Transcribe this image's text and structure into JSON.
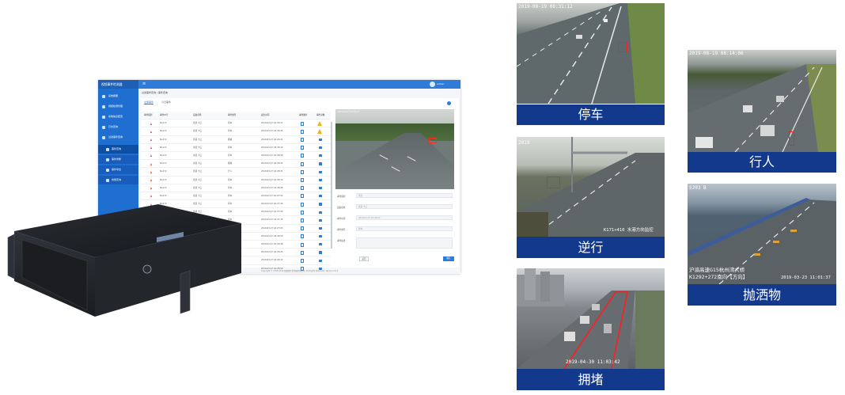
{
  "app": {
    "brand": "视频事件检测器",
    "menu_toggle": "≡",
    "user_name": "admin",
    "sidebar": [
      {
        "label": "系统概要"
      },
      {
        "label": "视频检测管理"
      },
      {
        "label": "系统信息配置"
      },
      {
        "label": "日志查询"
      },
      {
        "label": "过滤事件查询"
      },
      {
        "label": "事件查询"
      },
      {
        "label": "事件录像"
      },
      {
        "label": "事件导出"
      },
      {
        "label": "告警查询"
      }
    ],
    "breadcrumb": "过滤事件查询 / 事件查询",
    "tabs": [
      "全部事件",
      "今日事件"
    ],
    "table": {
      "headers": [
        "事件级别",
        "事件ID号",
        "设备名称",
        "事件类型",
        "发生时间",
        "事件图片",
        "事件录像"
      ],
      "rows": [
        {
          "id": "No172",
          "device": "省道·卡口",
          "type": "停车",
          "time": "2019-03-27 16:29:47"
        },
        {
          "id": "No172",
          "device": "省道·卡口",
          "type": "停车",
          "time": "2019-03-27 16:29:34"
        },
        {
          "id": "No172",
          "device": "省道·卡口",
          "type": "拥堵",
          "time": "2019-03-27 16:29:21"
        },
        {
          "id": "No172",
          "device": "省道·卡口",
          "type": "停车",
          "time": "2019-03-27 16:29:10"
        },
        {
          "id": "No172",
          "device": "省道·卡口",
          "type": "停车",
          "time": "2019-03-27 16:28:58"
        },
        {
          "id": "No172",
          "device": "省道·卡口",
          "type": "拥堵",
          "time": "2019-03-27 16:28:45"
        },
        {
          "id": "No172",
          "device": "省道·卡口",
          "type": "行人",
          "time": "2019-03-27 16:28:31"
        },
        {
          "id": "No172",
          "device": "省道·卡口",
          "type": "停车",
          "time": "2019-03-27 16:28:19"
        },
        {
          "id": "No172",
          "device": "省道·卡口",
          "type": "停车",
          "time": "2019-03-27 16:28:06"
        },
        {
          "id": "No172",
          "device": "省道·卡口",
          "type": "停车",
          "time": "2019-03-27 16:27:52"
        },
        {
          "id": "No172",
          "device": "省道·卡口",
          "type": "停车",
          "time": "2019-03-27 16:27:40"
        },
        {
          "id": "No172",
          "device": "省道·卡口",
          "type": "停车",
          "time": "2019-03-27 16:27:28"
        },
        {
          "id": "No172",
          "device": "省道·卡口",
          "type": "停车",
          "time": "2019-03-27 16:27:15"
        },
        {
          "id": "No172",
          "device": "省道·卡口",
          "type": "停车",
          "time": "2019-03-27 16:27:03"
        },
        {
          "id": "No172",
          "device": "省道·卡口",
          "type": "停车",
          "time": "2019-03-27 16:26:50"
        },
        {
          "id": "No172",
          "device": "省道·卡口",
          "type": "停车",
          "time": "2019-03-27 16:26:38"
        },
        {
          "id": "No172",
          "device": "省道·卡口",
          "type": "拥堵",
          "time": "2019-03-27 16:26:25"
        },
        {
          "id": "No172",
          "device": "省道·卡口",
          "type": "停车",
          "time": "2019-03-27 16:26:12"
        },
        {
          "id": "No172",
          "device": "省道·卡口",
          "type": "停车",
          "time": "2019-03-27 16:26:00"
        }
      ]
    },
    "preview_osd": "2019-03-27 16:29:47",
    "form": [
      {
        "label": "事件级别",
        "value": "紧急"
      },
      {
        "label": "设备名称",
        "value": "省道·卡口"
      },
      {
        "label": "事件时间",
        "value": "2019-03-27 16:29:47"
      },
      {
        "label": "事件类型",
        "value": "停车"
      },
      {
        "label": "事件描述",
        "value": ""
      }
    ],
    "btn_return": "返回",
    "btn_confirm": "确认",
    "footer": "Copyright © 2018-2019 视频事件检测器有限公司. All Rights Reserved. Version 2.0.0"
  },
  "tiles": {
    "parking": {
      "caption": "停车",
      "osd": "2019-08-19 08:31:12"
    },
    "pedestrian": {
      "caption": "行人",
      "osd": "2019-08-19 08:14:06"
    },
    "wrong_way": {
      "caption": "逆行",
      "osd_top": "2019",
      "osd_bottom": "K171+410 水港方向监控"
    },
    "debris": {
      "caption": "抛洒物",
      "osd_top": "S203 B",
      "osd_bottom1": "沪渝高速G15杭州湾大桥",
      "osd_bottom2": "K1292+272南向【方向】",
      "osd_date": "2019-03-23 11:01:37"
    },
    "congestion": {
      "caption": "拥堵",
      "osd": "2019-04-30 11:03:42"
    }
  },
  "colors": {
    "caption_bg": "#13398c",
    "app_blue": "#2f7bd8",
    "sidebar_blue": "#1f6fd1",
    "detection_red": "#ff1e1e",
    "alert_red": "#e64a3b",
    "warning_yellow": "#f2b01e"
  },
  "icons": [
    "menu-icon",
    "user-avatar",
    "home-icon",
    "monitor-icon",
    "settings-icon",
    "log-icon",
    "filter-icon",
    "event-icon",
    "video-icon",
    "export-icon",
    "alarm-icon",
    "refresh-icon",
    "alert-triangle-icon",
    "document-icon",
    "camera-icon",
    "warning-icon"
  ]
}
